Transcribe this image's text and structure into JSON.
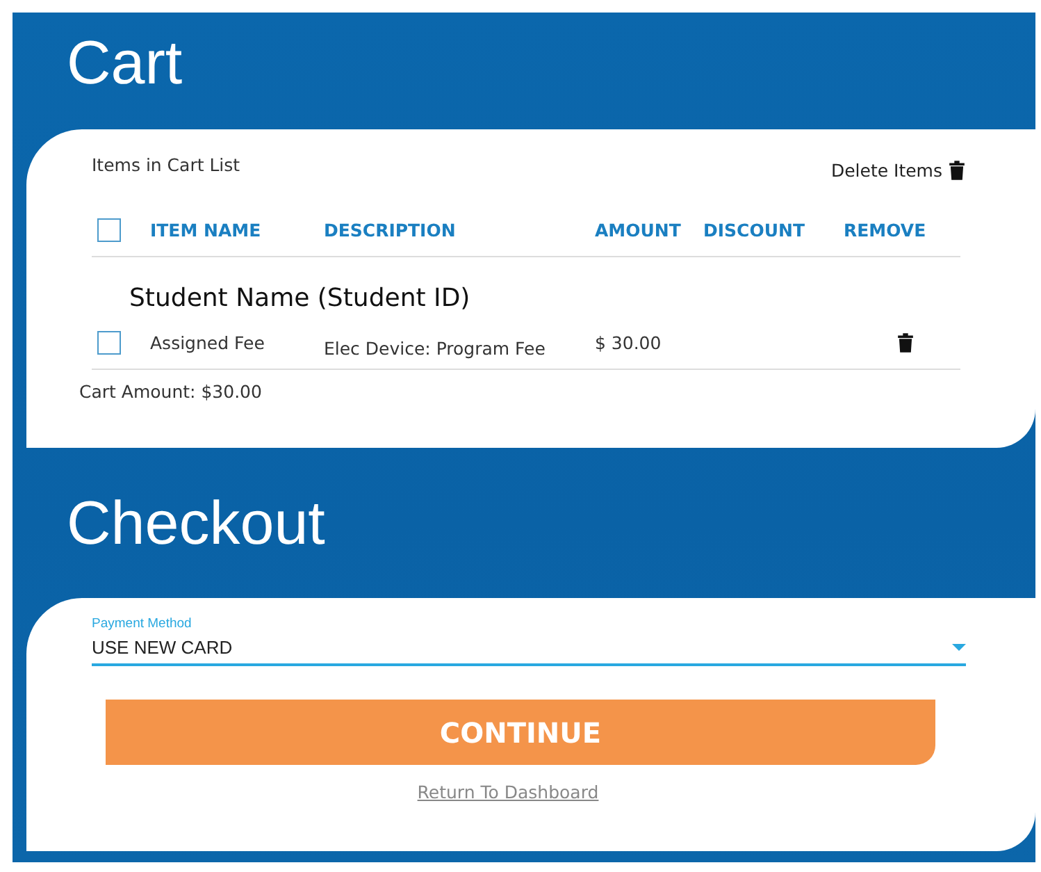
{
  "cart": {
    "title": "Cart",
    "list_title": "Items in Cart List",
    "delete_items": "Delete Items",
    "select_all": {
      "checked": false
    },
    "columns": [
      "ITEM NAME",
      "DESCRIPTION",
      "AMOUNT",
      "DISCOUNT",
      "REMOVE"
    ],
    "groups": [
      {
        "student": "Student Name (Student ID)",
        "items": [
          {
            "checked": false,
            "item_name": "Assigned Fee",
            "description": "Elec Device: Program Fee",
            "amount": "$ 30.00"
          }
        ]
      }
    ],
    "cart_amount": "Cart Amount: $30.00"
  },
  "checkout": {
    "title": "Checkout",
    "payment_method": {
      "label": "Payment Method",
      "value": "USE NEW CARD"
    },
    "continue_button": "CONTINUE",
    "return_link": "Return To Dashboard"
  }
}
